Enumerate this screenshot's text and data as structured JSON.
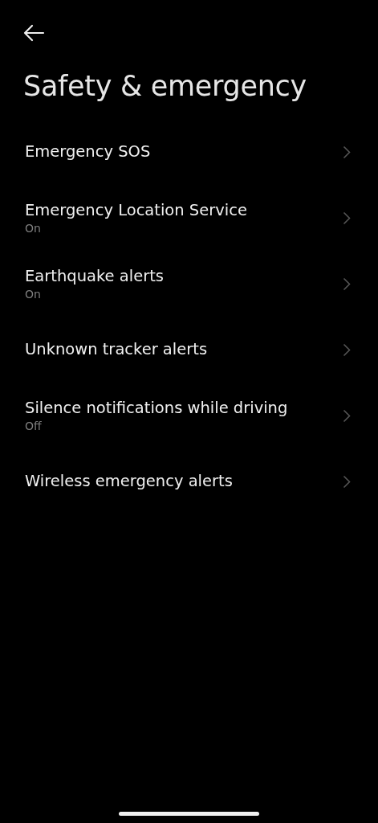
{
  "header": {
    "title": "Safety & emergency"
  },
  "items": [
    {
      "label": "Emergency SOS"
    },
    {
      "label": "Emergency Location Service",
      "status": "On"
    },
    {
      "label": "Earthquake alerts",
      "status": "On"
    },
    {
      "label": "Unknown tracker alerts"
    },
    {
      "label": "Silence notifications while driving",
      "status": "Off"
    },
    {
      "label": "Wireless emergency alerts"
    }
  ]
}
